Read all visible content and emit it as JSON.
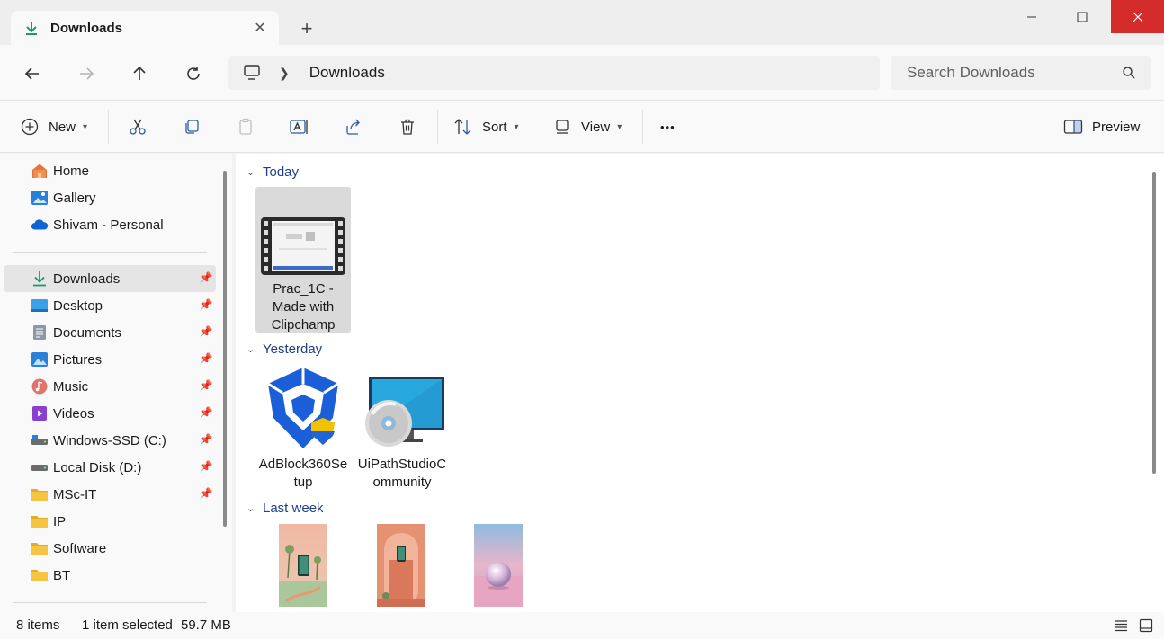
{
  "window": {
    "tab_title": "Downloads",
    "tab_close_glyph": "✕",
    "new_tab_glyph": "+"
  },
  "address": {
    "breadcrumb": [
      "Downloads"
    ],
    "search_placeholder": "Search Downloads"
  },
  "toolbar": {
    "new_label": "New",
    "sort_label": "Sort",
    "view_label": "View",
    "more_glyph": "•••",
    "preview_label": "Preview"
  },
  "sidebar": {
    "quick": [
      {
        "label": "Home",
        "icon": "home-icon"
      },
      {
        "label": "Gallery",
        "icon": "gallery-icon"
      },
      {
        "label": "Shivam - Personal",
        "icon": "onedrive-icon"
      }
    ],
    "pinned": [
      {
        "label": "Downloads",
        "icon": "downloads-icon",
        "pinned": true,
        "selected": true
      },
      {
        "label": "Desktop",
        "icon": "desktop-icon",
        "pinned": true
      },
      {
        "label": "Documents",
        "icon": "documents-icon",
        "pinned": true
      },
      {
        "label": "Pictures",
        "icon": "pictures-icon",
        "pinned": true
      },
      {
        "label": "Music",
        "icon": "music-icon",
        "pinned": true
      },
      {
        "label": "Videos",
        "icon": "videos-icon",
        "pinned": true
      },
      {
        "label": "Windows-SSD (C:)",
        "icon": "drive-icon",
        "pinned": true
      },
      {
        "label": "Local Disk (D:)",
        "icon": "drive-icon",
        "pinned": true
      },
      {
        "label": "MSc-IT",
        "icon": "folder-icon",
        "pinned": true
      },
      {
        "label": "IP",
        "icon": "folder-icon",
        "pinned": false
      },
      {
        "label": "Software",
        "icon": "folder-icon",
        "pinned": false
      },
      {
        "label": "BT",
        "icon": "folder-icon",
        "pinned": false
      }
    ]
  },
  "groups": [
    {
      "title": "Today",
      "files": [
        {
          "name": "Prac_1C - Made with Clipchamp",
          "type": "video",
          "selected": true
        }
      ]
    },
    {
      "title": "Yesterday",
      "files": [
        {
          "name": "AdBlock360Setup",
          "type": "installer"
        },
        {
          "name": "UiPathStudioCommunity",
          "type": "installer"
        }
      ]
    },
    {
      "title": "Last week",
      "files": [
        {
          "name": "",
          "type": "image"
        },
        {
          "name": "",
          "type": "image"
        },
        {
          "name": "",
          "type": "image"
        }
      ]
    }
  ],
  "status": {
    "item_count": "8 items",
    "selection": "1 item selected",
    "size": "59.7 MB"
  },
  "colors": {
    "accent": "#1f3f8a",
    "close_button": "#d42b2b",
    "downloads_green": "#1a9a6b",
    "folder_yellow": "#f5c542"
  }
}
